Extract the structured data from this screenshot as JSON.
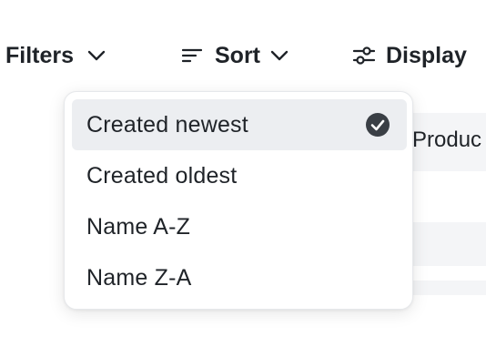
{
  "toolbar": {
    "filters_label": "Filters",
    "sort_label": "Sort",
    "display_label": "Display"
  },
  "background": {
    "column_header_partial": "Produc"
  },
  "sort_menu": {
    "items": [
      {
        "label": "Created newest",
        "selected": true
      },
      {
        "label": "Created oldest",
        "selected": false
      },
      {
        "label": "Name A-Z",
        "selected": false
      },
      {
        "label": "Name Z-A",
        "selected": false
      }
    ]
  },
  "icons": {
    "filters": "filter-icon",
    "sort": "sort-lines-icon",
    "display": "sliders-icon",
    "chevron": "chevron-down-icon",
    "selected": "check-circle-icon"
  },
  "colors": {
    "text": "#1f2328",
    "selected_bg": "#eceef1",
    "check_fill": "#3a3f45",
    "table_bg": "#f4f5f7"
  }
}
